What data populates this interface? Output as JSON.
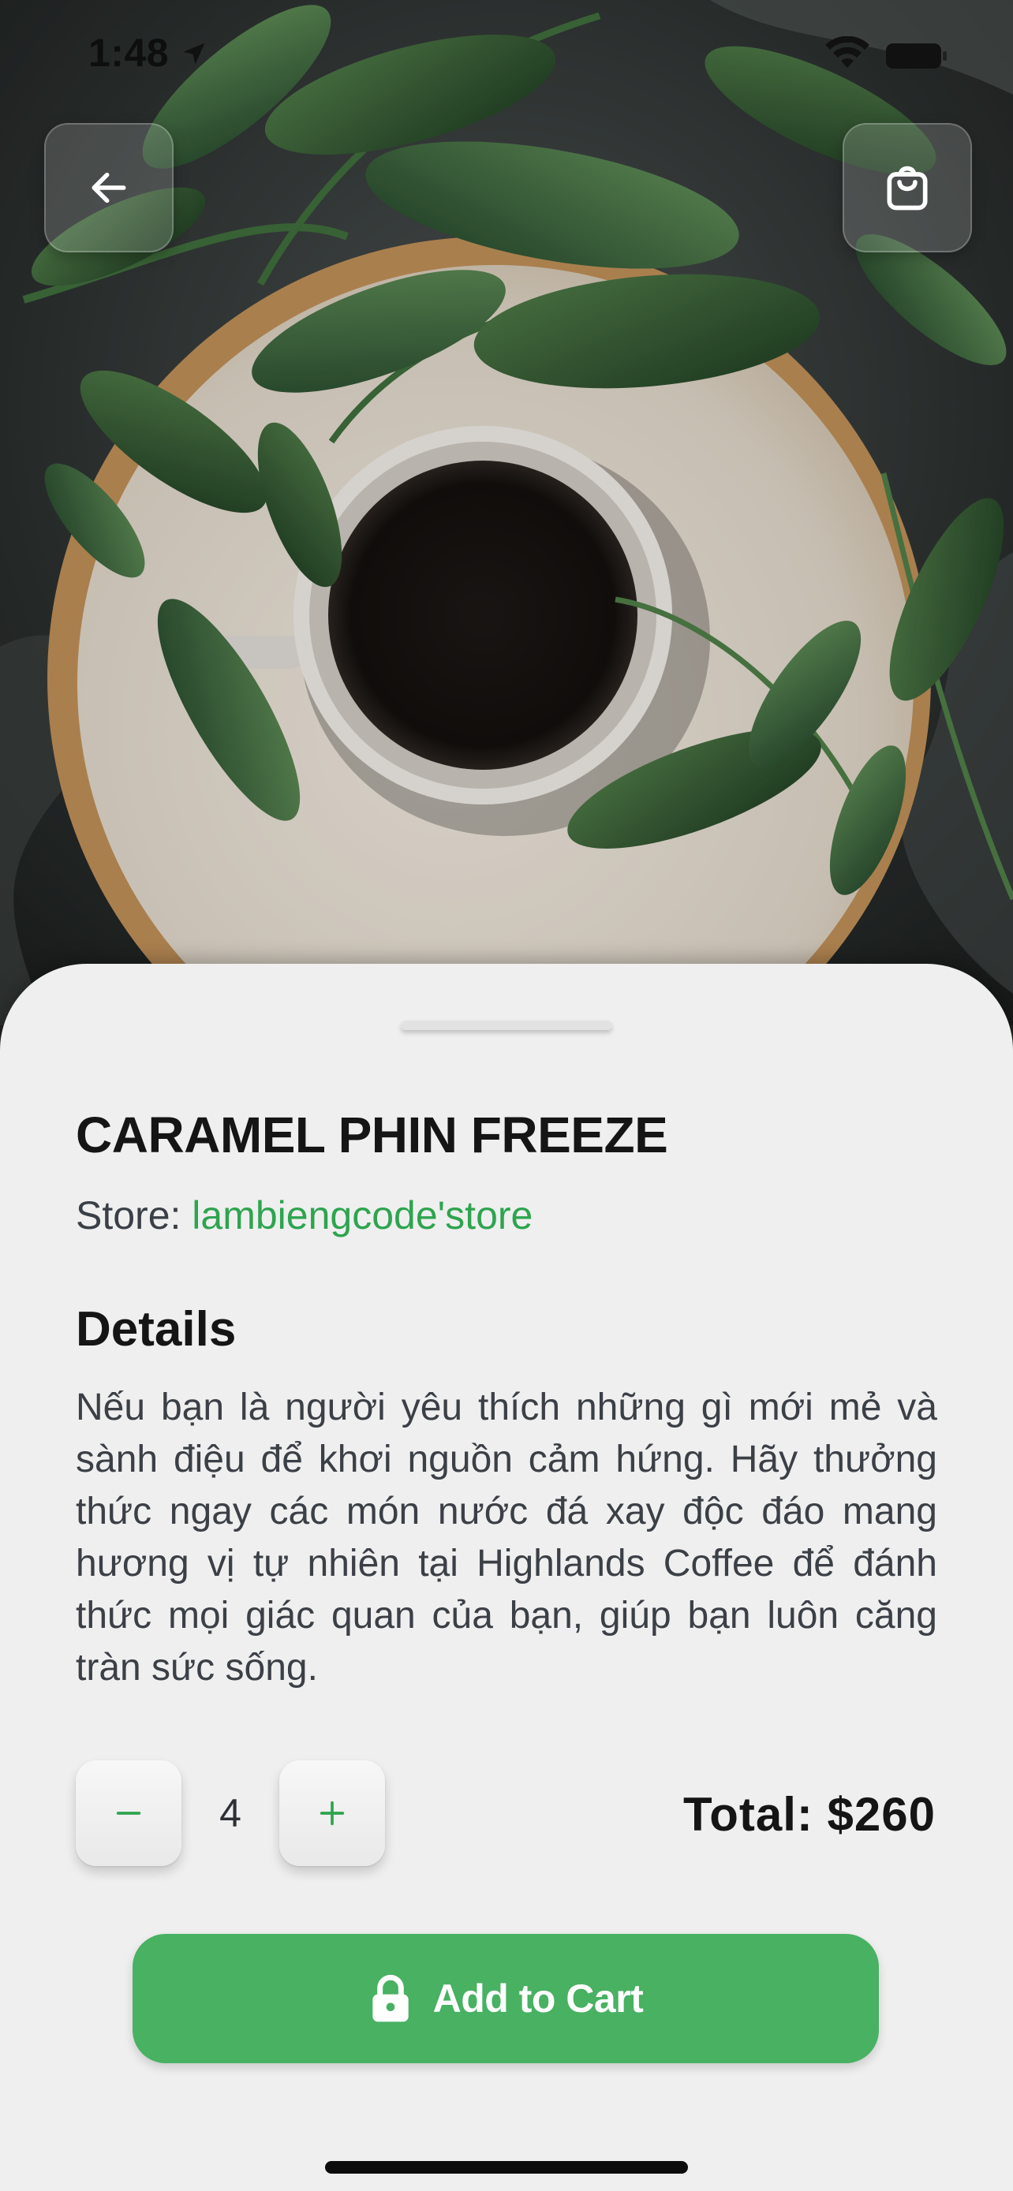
{
  "status_bar": {
    "time": "1:48",
    "icons": [
      "location-arrow-icon",
      "wifi-icon",
      "battery-icon"
    ]
  },
  "hero": {
    "image": "coffee-cup-with-green-leaves-on-wooden-tray",
    "back_icon": "arrow-left-icon",
    "cart_icon": "shopping-bag-icon"
  },
  "product": {
    "title": "CARAMEL PHIN FREEZE",
    "store_label": "Store: ",
    "store_name": "lambiengcode'store",
    "details_heading": "Details",
    "details_text": "Nếu bạn là người yêu thích những gì mới mẻ và sành điệu để khơi nguồn cảm hứng. Hãy thưởng thức ngay các món nước đá xay độc đáo mang hương vị tự nhiên tại Highlands Coffee để đánh thức mọi giác quan của bạn, giúp bạn luôn căng tràn sức sống."
  },
  "cart": {
    "quantity": "4",
    "minus_icon": "minus-icon",
    "plus_icon": "plus-icon",
    "total": "Total: $260",
    "add_label": "Add to Cart",
    "add_icon": "lock-icon"
  },
  "colors": {
    "accent": "#48b162",
    "store_green": "#2ea44f",
    "sheet_bg": "#efefef",
    "text_dark": "#151515"
  }
}
